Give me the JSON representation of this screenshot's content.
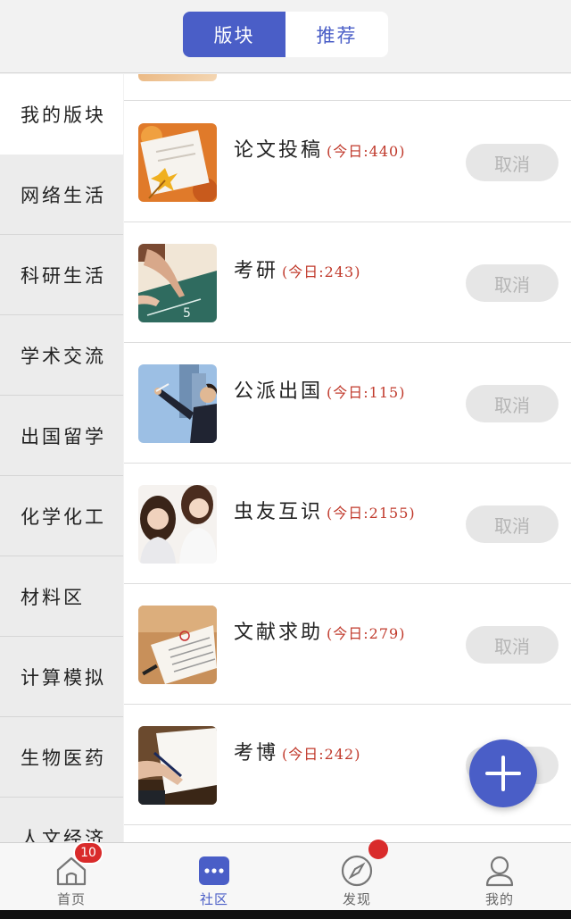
{
  "header": {
    "tabs": [
      {
        "label": "版块",
        "active": true
      },
      {
        "label": "推荐",
        "active": false
      }
    ]
  },
  "sidebar": {
    "items": [
      {
        "label": "我的版块",
        "active": true
      },
      {
        "label": "网络生活"
      },
      {
        "label": "科研生活"
      },
      {
        "label": "学术交流"
      },
      {
        "label": "出国留学"
      },
      {
        "label": "化学化工"
      },
      {
        "label": "材料区"
      },
      {
        "label": "计算模拟"
      },
      {
        "label": "生物医药"
      },
      {
        "label": "人文经济"
      }
    ]
  },
  "boards": [
    {
      "title": "论文投稿",
      "count": "(今日:440)",
      "action": "取消",
      "icon": "paper-leaf-thumbnail"
    },
    {
      "title": "考研",
      "count": "(今日:243)",
      "action": "取消",
      "icon": "chalkboard-thumbnail"
    },
    {
      "title": "公派出国",
      "count": "(今日:115)",
      "action": "取消",
      "icon": "presenter-thumbnail"
    },
    {
      "title": "虫友互识",
      "count": "(今日:2155)",
      "action": "取消",
      "icon": "friends-thumbnail"
    },
    {
      "title": "文献求助",
      "count": "(今日:279)",
      "action": "取消",
      "icon": "book-thumbnail"
    },
    {
      "title": "考博",
      "count": "(今日:242)",
      "action": "取消",
      "icon": "writing-thumbnail"
    }
  ],
  "fab": {
    "icon": "plus-icon"
  },
  "bottom_nav": {
    "items": [
      {
        "label": "首页",
        "icon": "home-icon",
        "badge": "10"
      },
      {
        "label": "社区",
        "icon": "community-icon",
        "active": true
      },
      {
        "label": "发现",
        "icon": "compass-icon",
        "dot": true
      },
      {
        "label": "我的",
        "icon": "user-icon"
      }
    ]
  },
  "colors": {
    "accent": "#4a5ec7",
    "count_red": "#c0392b",
    "badge_red": "#d92b2b"
  }
}
